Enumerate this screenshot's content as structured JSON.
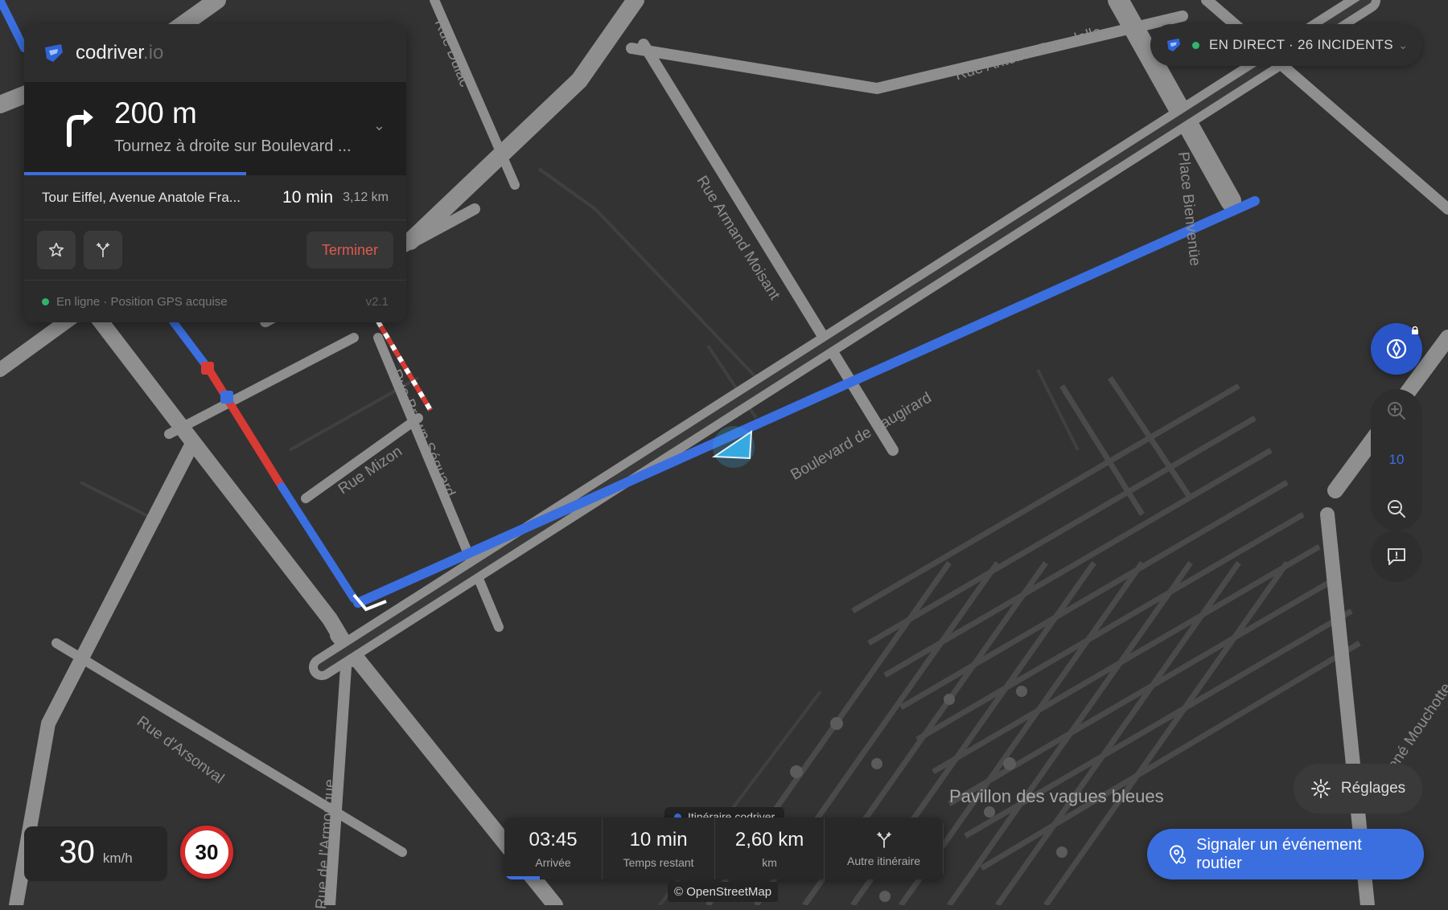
{
  "map": {
    "streets": [
      "Rue Antoine Bourdelle",
      "Rue Dulac",
      "Rue Armand Moisant",
      "Place Bienvenüe",
      "Rue Brown Séquard",
      "Rue Mizon",
      "Boulevard de Vaugirard",
      "Rue d'Arsonval",
      "Rue de l'Armorique",
      "Rue René Mouchotte"
    ],
    "place": "Pavillon des vagues bleues",
    "colors": {
      "background": "#333333",
      "road": "#8f8f8f",
      "route": "#3b6fe0",
      "traffic": "#d83a34",
      "vehicle": "#36a9e0"
    }
  },
  "nav": {
    "brand_name": "codriver",
    "brand_suffix": ".io",
    "turn_distance": "200 m",
    "turn_instruction": "Tournez à droite sur Boulevard ...",
    "turn_progress": 0.58,
    "destination": "Tour Eiffel, Avenue Anatole Fra...",
    "eta_minutes": "10 min",
    "remaining_distance": "3,12 km",
    "end_label": "Terminer",
    "status": "En ligne · Position GPS acquise",
    "version": "v2.1"
  },
  "live": {
    "label": "EN DIRECT · 26 INCIDENTS"
  },
  "controls": {
    "zoom_level": "10"
  },
  "settings": {
    "label": "Réglages"
  },
  "report": {
    "label": "Signaler un événement routier"
  },
  "trip": {
    "route_badge": "Itinéraire codriver",
    "arrival_value": "03:45",
    "arrival_label": "Arrivée",
    "remaining_value": "10 min",
    "remaining_label": "Temps restant",
    "distance_value": "2,60 km",
    "distance_label": "km",
    "alt_label": "Autre itinéraire",
    "progress": 0.08
  },
  "attribution": "© OpenStreetMap",
  "speed": {
    "value": "30",
    "unit": "km/h",
    "limit": "30"
  }
}
